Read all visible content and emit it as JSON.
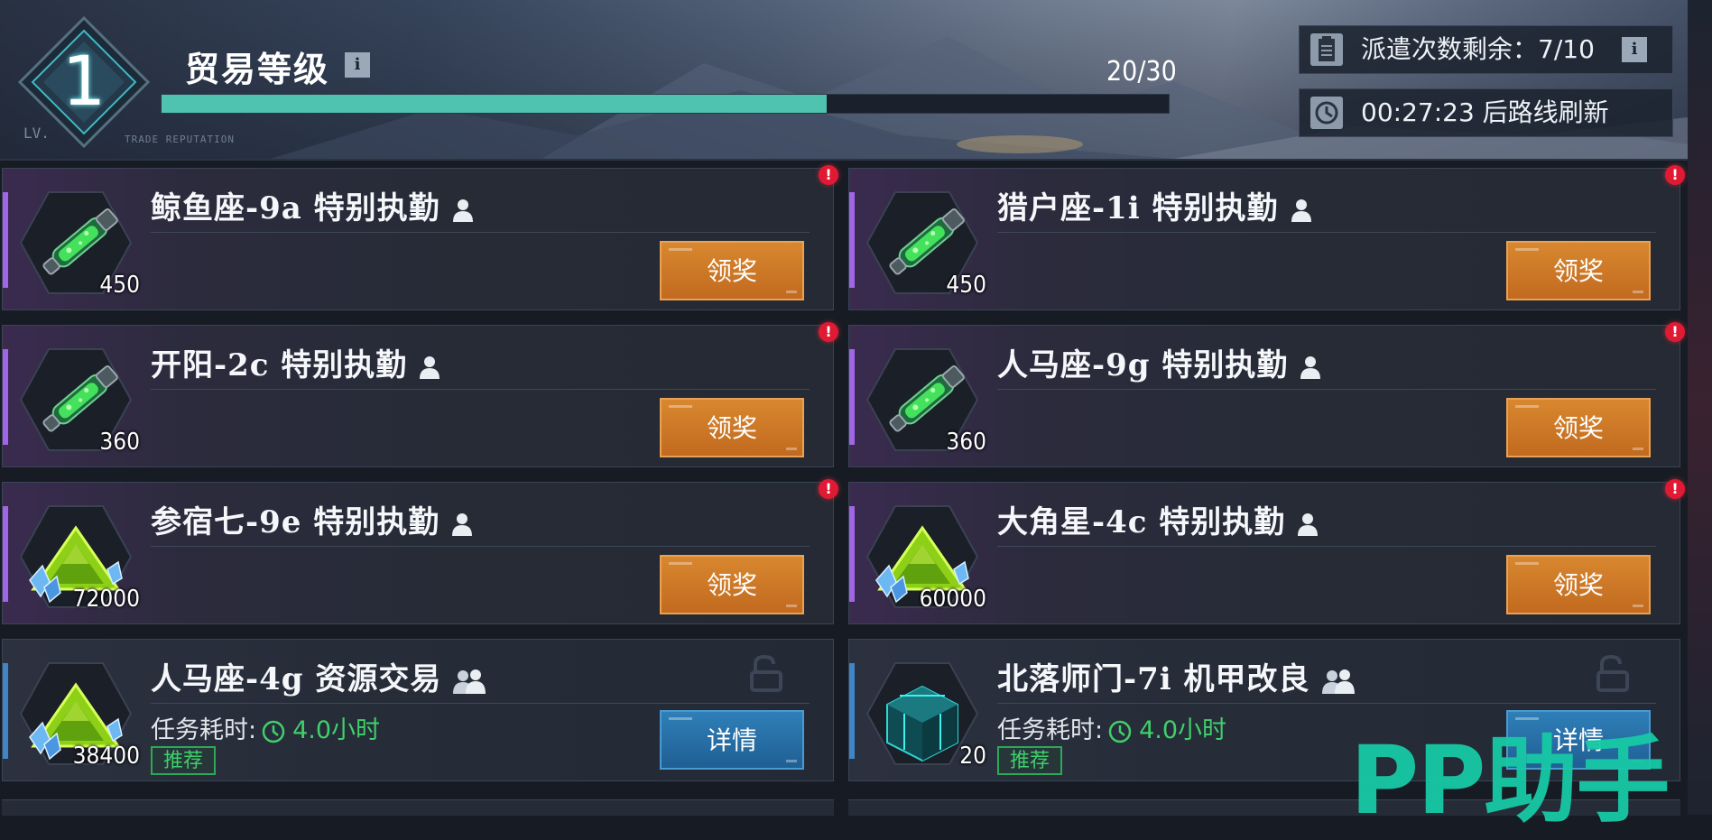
{
  "header": {
    "level": "1",
    "level_tag": "LV.",
    "trade_label": "TRADE REPUTATION",
    "title": "贸易等级",
    "info_glyph": "i",
    "xp_text": "20/30",
    "xp_progress": 0.66,
    "dispatch_text": "派遣次数剩余：7/10",
    "refresh_text": "00:27:23 后路线刷新"
  },
  "missions": [
    {
      "title": "鲸鱼座-9a 特别执勤",
      "qty": "450",
      "item": "green-vial-icon",
      "state": "claim",
      "button": "领奖",
      "alert": "!"
    },
    {
      "title": "猎户座-1i 特别执勤",
      "qty": "450",
      "item": "green-vial-icon",
      "state": "claim",
      "button": "领奖",
      "alert": "!"
    },
    {
      "title": "开阳-2c 特别执勤",
      "qty": "360",
      "item": "green-vial-icon",
      "state": "claim",
      "button": "领奖",
      "alert": "!"
    },
    {
      "title": "人马座-9g 特别执勤",
      "qty": "360",
      "item": "green-vial-icon",
      "state": "claim",
      "button": "领奖",
      "alert": "!"
    },
    {
      "title": "参宿七-9e 特别执勤",
      "qty": "72000",
      "item": "green-crystal-icon",
      "state": "claim",
      "button": "领奖",
      "alert": "!"
    },
    {
      "title": "大角星-4c 特别执勤",
      "qty": "60000",
      "item": "green-crystal-icon",
      "state": "claim",
      "button": "领奖",
      "alert": "!"
    },
    {
      "title": "人马座-4g 资源交易",
      "qty": "38400",
      "item": "green-crystal-icon",
      "state": "open",
      "button": "详情",
      "duration_label": "任务耗时:",
      "duration_value": "4.0小时",
      "tag": "推荐"
    },
    {
      "title": "北落师门-7i 机甲改良",
      "qty": "20",
      "item": "teal-cube-icon",
      "state": "open",
      "button": "详情",
      "duration_label": "任务耗时:",
      "duration_value": "4.0小时",
      "tag": "推荐"
    }
  ],
  "watermark": "PP助手",
  "colors": {
    "claim_button": "#c9762a",
    "detail_button": "#2a74ad",
    "xp_fill": "#4fc2b0",
    "done_accent": "#a166e8",
    "open_accent": "#3f86c9",
    "alert": "#e11a34",
    "recommend": "#3fd06a"
  }
}
